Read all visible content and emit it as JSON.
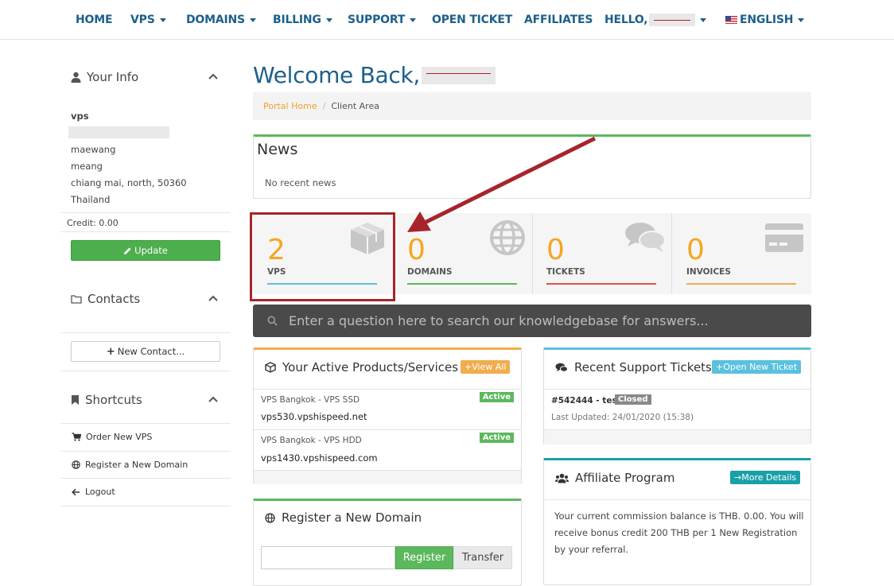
{
  "nav": {
    "home": "HOME",
    "vps": "VPS",
    "domains": "DOMAINS",
    "billing": "BILLING",
    "support": "SUPPORT",
    "open_ticket": "OPEN TICKET",
    "affiliates": "AFFILIATES",
    "hello": "HELLO,",
    "language": "ENGLISH"
  },
  "sidebar": {
    "your_info": {
      "title": "Your Info",
      "company": "vps",
      "lines": [
        "maewang",
        "meang",
        "chiang mai, north, 50360",
        "Thailand"
      ],
      "credit": "Credit: 0.00",
      "update_label": "Update"
    },
    "contacts": {
      "title": "Contacts",
      "new_contact_label": "New Contact..."
    },
    "shortcuts": {
      "title": "Shortcuts",
      "items": [
        "Order New VPS",
        "Register a New Domain",
        "Logout"
      ]
    }
  },
  "main": {
    "welcome": "Welcome Back,",
    "breadcrumb": {
      "home": "Portal Home",
      "current": "Client Area"
    },
    "news": {
      "title": "News",
      "empty": "No recent news"
    },
    "tiles": [
      {
        "count": "2",
        "label": "VPS",
        "color": "#5bc0de",
        "icon": "cube-icon"
      },
      {
        "count": "0",
        "label": "DOMAINS",
        "color": "#5cb85c",
        "icon": "globe-icon"
      },
      {
        "count": "0",
        "label": "TICKETS",
        "color": "#d9534f",
        "icon": "comments-icon"
      },
      {
        "count": "0",
        "label": "INVOICES",
        "color": "#f0ad4e",
        "icon": "credit-card-icon"
      }
    ],
    "search_placeholder": "Enter a question here to search our knowledgebase for answers...",
    "products": {
      "title": "Your Active Products/Services",
      "view_all": "View All",
      "items": [
        {
          "name": "VPS Bangkok - VPS SSD",
          "host": "vps530.vpshispeed.net",
          "status": "Active"
        },
        {
          "name": "VPS Bangkok - VPS HDD",
          "host": "vps1430.vpshispeed.com",
          "status": "Active"
        }
      ]
    },
    "tickets": {
      "title": "Recent Support Tickets",
      "open_new": "Open New Ticket",
      "items": [
        {
          "subject": "#542444 - test",
          "status": "Closed",
          "updated": "Last Updated: 24/01/2020 (15:38)"
        }
      ]
    },
    "domain": {
      "title": "Register a New Domain",
      "register": "Register",
      "transfer": "Transfer"
    },
    "affiliate": {
      "title": "Affiliate Program",
      "more": "More Details",
      "text": "Your current commission balance is THB. 0.00. You will receive bonus credit 200 THB per 1 New Registration by your referral."
    }
  },
  "colors": {
    "brand": "#1d5f8a",
    "accent": "#f5a623",
    "annotation": "#a8242c"
  }
}
